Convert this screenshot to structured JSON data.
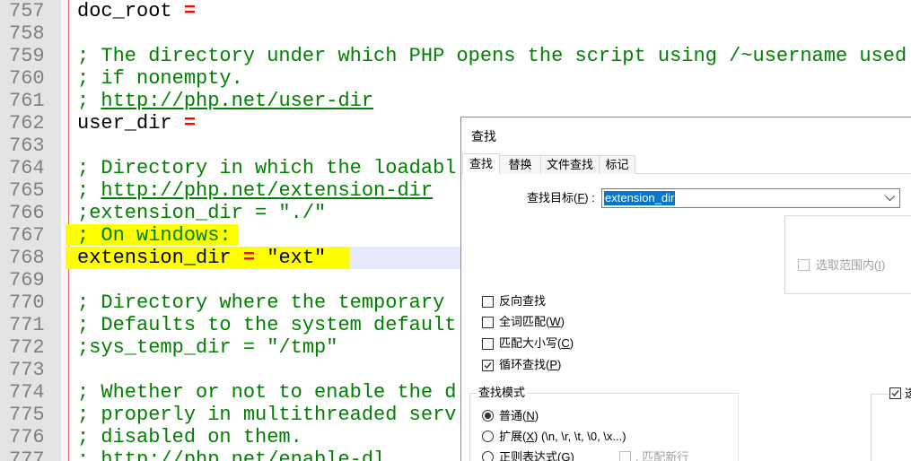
{
  "editor": {
    "colors": {
      "comment": "#008000",
      "operator": "#ff0000",
      "text": "#000000",
      "line_number": "#808080",
      "gutter": "#e4e4e4",
      "current_line": "#e8e8ff",
      "marker": "#ffff00",
      "edge_line": "#e46464"
    },
    "current_line": 768,
    "marked_lines": [
      767,
      768
    ],
    "lines": [
      {
        "num": "757",
        "tokens": [
          {
            "text": "doc_root ",
            "color": "#000000"
          },
          {
            "text": "=",
            "color": "#ff0000",
            "bold": true
          }
        ]
      },
      {
        "num": "758",
        "tokens": []
      },
      {
        "num": "759",
        "tokens": [
          {
            "text": "; The directory under which PHP opens the script using /~username used",
            "color": "#008000"
          }
        ]
      },
      {
        "num": "760",
        "tokens": [
          {
            "text": "; if nonempty.",
            "color": "#008000"
          }
        ]
      },
      {
        "num": "761",
        "tokens": [
          {
            "text": "; ",
            "color": "#008000"
          },
          {
            "text": "http://php.net/user-dir",
            "color": "#008000",
            "underline": true
          }
        ]
      },
      {
        "num": "762",
        "tokens": [
          {
            "text": "user_dir ",
            "color": "#000000"
          },
          {
            "text": "=",
            "color": "#ff0000",
            "bold": true
          }
        ]
      },
      {
        "num": "763",
        "tokens": []
      },
      {
        "num": "764",
        "tokens": [
          {
            "text": "; Directory in which the loadabl",
            "color": "#008000"
          }
        ]
      },
      {
        "num": "765",
        "tokens": [
          {
            "text": "; ",
            "color": "#008000"
          },
          {
            "text": "http://php.net/extension-dir",
            "color": "#008000",
            "underline": true
          }
        ]
      },
      {
        "num": "766",
        "tokens": [
          {
            "text": ";extension_dir = \"./\"",
            "color": "#008000"
          }
        ]
      },
      {
        "num": "767",
        "tokens": [
          {
            "text": "; On windows:",
            "color": "#008000"
          }
        ]
      },
      {
        "num": "768",
        "tokens": [
          {
            "text": "extension_dir ",
            "color": "#000000"
          },
          {
            "text": "=",
            "color": "#ff0000",
            "bold": true
          },
          {
            "text": " \"ext\"",
            "color": "#000000"
          }
        ]
      },
      {
        "num": "769",
        "tokens": []
      },
      {
        "num": "770",
        "tokens": [
          {
            "text": "; Directory where the temporary",
            "color": "#008000"
          }
        ]
      },
      {
        "num": "771",
        "tokens": [
          {
            "text": "; Defaults to the system default",
            "color": "#008000"
          }
        ]
      },
      {
        "num": "772",
        "tokens": [
          {
            "text": ";sys_temp_dir = \"/tmp\"",
            "color": "#008000"
          }
        ]
      },
      {
        "num": "773",
        "tokens": []
      },
      {
        "num": "774",
        "tokens": [
          {
            "text": "; Whether or not to enable the d",
            "color": "#008000"
          }
        ]
      },
      {
        "num": "775",
        "tokens": [
          {
            "text": "; properly in multithreaded serv",
            "color": "#008000"
          }
        ]
      },
      {
        "num": "776",
        "tokens": [
          {
            "text": "; disabled on them.",
            "color": "#008000"
          }
        ]
      },
      {
        "num": "777",
        "tokens": [
          {
            "text": "; ",
            "color": "#008000"
          },
          {
            "text": "http://php.net/enable-dl",
            "color": "#008000",
            "underline": true
          }
        ]
      }
    ]
  },
  "find_dialog": {
    "title": "查找",
    "tabs": [
      {
        "label": "查找",
        "selected": true
      },
      {
        "label": "替换",
        "selected": false
      },
      {
        "label": "文件查找",
        "selected": false
      },
      {
        "label": "标记",
        "selected": false
      }
    ],
    "find_what": {
      "label_pre": "查找目标(",
      "label_key": "F",
      "label_post": ") :",
      "value": "extension_dir",
      "value_selected": true
    },
    "in_selection": {
      "pre": "选取范围内(",
      "key": "I",
      "post": ")",
      "checked": false,
      "enabled": false
    },
    "options": [
      {
        "pre": "反向查找",
        "key": "",
        "post": "",
        "checked": false
      },
      {
        "pre": "全词匹配(",
        "key": "W",
        "post": ")",
        "checked": false
      },
      {
        "pre": "匹配大小写(",
        "key": "C",
        "post": ")",
        "checked": false
      },
      {
        "pre": "循环查找(",
        "key": "P",
        "post": ")",
        "checked": true
      }
    ],
    "search_mode": {
      "title": "查找模式",
      "modes": [
        {
          "pre": "普通(",
          "key": "N",
          "post": ")",
          "selected": true
        },
        {
          "pre": "扩展(",
          "key": "X",
          "post": ") (\\n, \\r, \\t, \\0, \\x...)",
          "selected": false
        },
        {
          "pre": "正则表达式(",
          "key": "G",
          "post": ")",
          "selected": false
        }
      ],
      "dot_newline": {
        "label": ". 匹配新行",
        "checked": false,
        "enabled": false
      }
    },
    "transparency": {
      "label": "透",
      "checked": true
    }
  }
}
